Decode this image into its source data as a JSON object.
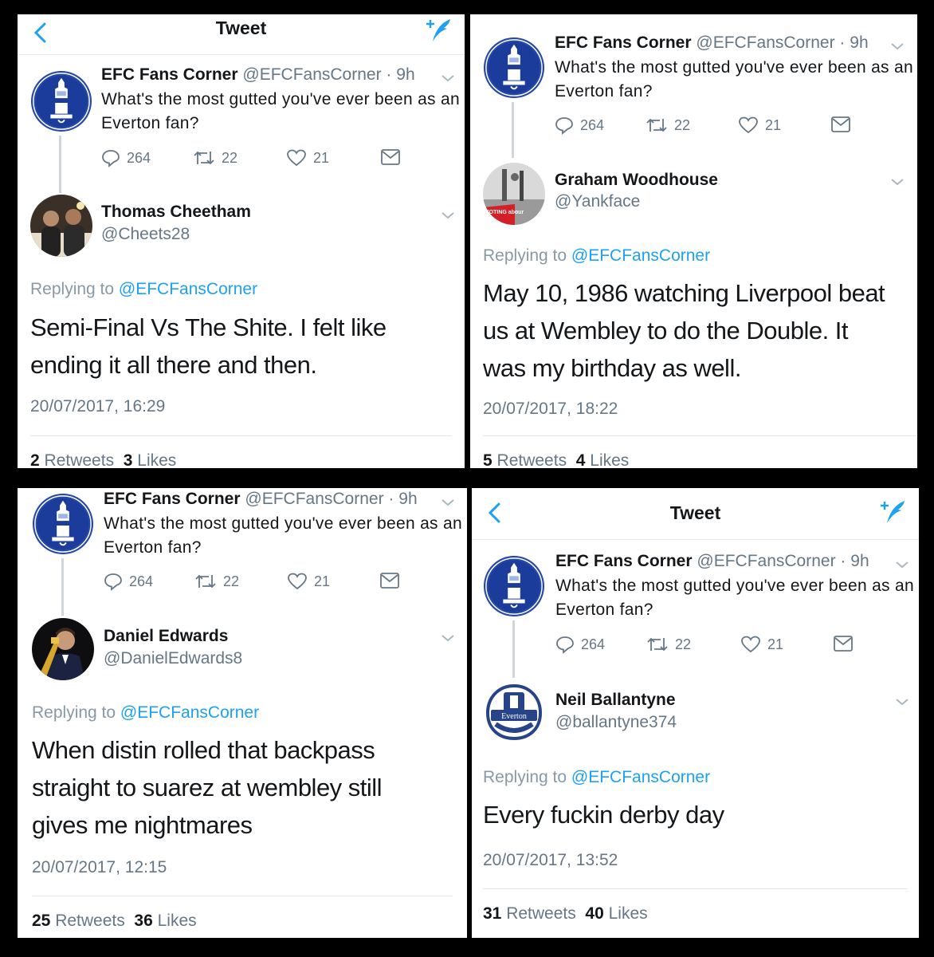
{
  "colors": {
    "accent": "#1da1f2",
    "muted": "#657786",
    "border": "#e1e8ed",
    "text": "#14171a"
  },
  "icons": {
    "back": "chevron-left-icon",
    "compose": "compose-tweet-icon",
    "reply": "reply-icon",
    "retweet": "retweet-icon",
    "like": "heart-icon",
    "message": "direct-message-icon",
    "more": "chevron-down-icon"
  },
  "nav": {
    "title": "Tweet"
  },
  "original": {
    "name": "EFC Fans Corner",
    "handle": "@EFCFansCorner",
    "sep": "·",
    "age": "9h",
    "text": "What's the most gutted you've ever been as an Everton fan?",
    "replies": "264",
    "retweets": "22",
    "likes": "21"
  },
  "labels": {
    "replying_to": "Replying to",
    "retweets": "Retweets",
    "likes": "Likes"
  },
  "panels": [
    {
      "reply_name": "Thomas Cheetham",
      "reply_handle": "@Cheets28",
      "mention": "@EFCFansCorner",
      "body_lines": [
        "Semi-Final Vs The Shite. I felt like",
        "ending it all there and then."
      ],
      "timestamp": "20/07/2017, 16:29",
      "retweet_count": "2",
      "like_count": "3"
    },
    {
      "reply_name": "Graham Woodhouse",
      "reply_handle": "@Yankface",
      "avatar_text": "VOTING abour",
      "mention": "@EFCFansCorner",
      "body_lines": [
        "May 10, 1986 watching Liverpool beat",
        "us at Wembley to do the Double. It",
        "was my birthday as well."
      ],
      "timestamp": "20/07/2017, 18:22",
      "retweet_count": "5",
      "like_count": "4"
    },
    {
      "reply_name": "Daniel Edwards",
      "reply_handle": "@DanielEdwards8",
      "mention": "@EFCFansCorner",
      "body_lines": [
        "When distin rolled that backpass",
        "straight to suarez at wembley still",
        "gives me nightmares"
      ],
      "timestamp": "20/07/2017, 12:15",
      "retweet_count": "25",
      "like_count": "36"
    },
    {
      "reply_name": "Neil Ballantyne",
      "reply_handle": "@ballantyne374",
      "avatar_text": "Everton",
      "mention": "@EFCFansCorner",
      "body_lines": [
        "Every fuckin derby day"
      ],
      "timestamp": "20/07/2017, 13:52",
      "retweet_count": "31",
      "like_count": "40"
    }
  ]
}
